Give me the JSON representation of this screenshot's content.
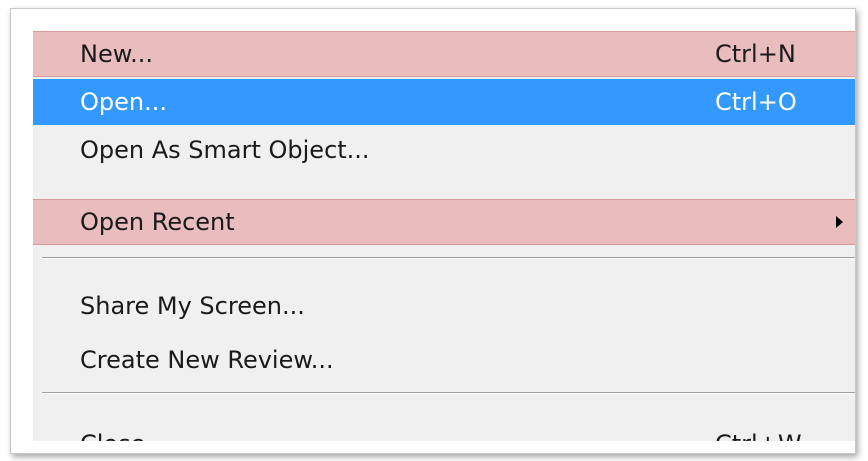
{
  "menu": {
    "items": [
      {
        "label": "New...",
        "shortcut": "Ctrl+N"
      },
      {
        "label": "Open...",
        "shortcut": "Ctrl+O"
      },
      {
        "label": "Open As Smart Object...",
        "shortcut": ""
      },
      {
        "label": "Open Recent",
        "shortcut": ""
      },
      {
        "label": "Share My Screen...",
        "shortcut": ""
      },
      {
        "label": "Create New Review...",
        "shortcut": ""
      },
      {
        "label": "Close",
        "shortcut": "Ctrl+W"
      }
    ],
    "selected_item": "Open...",
    "submenu_icon": "triangle-right-icon"
  },
  "colors": {
    "menu_background": "#f0f0f0",
    "selection": "#3399ff",
    "highlight_band": "#e9bcbd"
  }
}
